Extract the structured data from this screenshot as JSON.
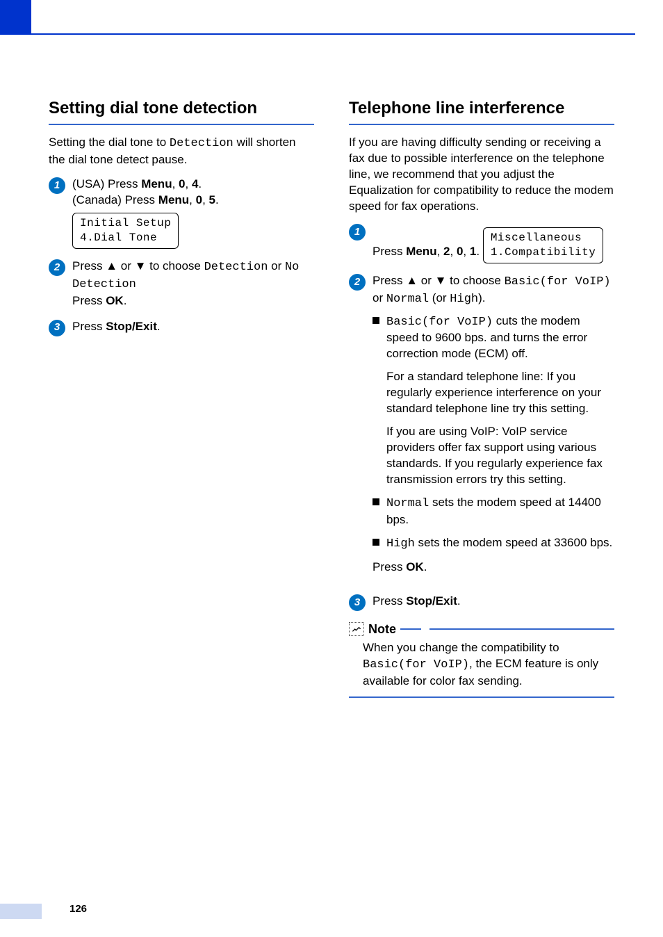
{
  "page_number": "126",
  "left": {
    "heading": "Setting dial tone detection",
    "intro_pre": "Setting the dial tone to ",
    "intro_mono": "Detection",
    "intro_post": " will shorten the dial tone detect pause.",
    "step1_usa_pre": "(USA) Press ",
    "step1_menu": "Menu",
    "sep1": ", ",
    "step1_a": "0",
    "step1_b": "4",
    "step1_canada_pre": "(Canada) Press ",
    "step1_c": "5",
    "step1_period": ".",
    "lcd": "Initial Setup\n4.Dial Tone",
    "step2_pre": "Press ",
    "step2_up": "a",
    "step2_or1": " or ",
    "step2_down": "b",
    "step2_mid": " to choose ",
    "step2_opt1": "Detection",
    "step2_or2": " or ",
    "step2_opt2": "No Detection",
    "step2_press": "Press ",
    "step2_ok": "OK",
    "step3_pre": "Press ",
    "step3_btn": "Stop/Exit"
  },
  "right": {
    "heading": "Telephone line interference",
    "intro": "If you are having difficulty sending or receiving a fax due to possible interference on the telephone line, we recommend that you adjust the Equalization for compatibility to reduce the modem speed for fax operations.",
    "step1_pre": "Press ",
    "step1_menu": "Menu",
    "sep": ", ",
    "step1_a": "2",
    "step1_b": "0",
    "step1_c": "1",
    "period": ".",
    "lcd": "Miscellaneous\n1.Compatibility",
    "step2_pre": "Press ",
    "step2_up": "a",
    "step2_or1": " or ",
    "step2_down": "b",
    "step2_mid": " to choose ",
    "step2_opt1": "Basic(for VoIP)",
    "step2_or2": " or ",
    "step2_opt2": "Normal",
    "step2_paren_or": " (or ",
    "step2_opt3": "High",
    "step2_paren_close": ").",
    "b1_mono": "Basic(for VoIP)",
    "b1_rest": " cuts the modem speed to 9600 bps. and turns the error correction mode (ECM) off.",
    "b1_p2": "For a standard telephone line: If you regularly experience interference on your standard telephone line try this setting.",
    "b1_p3": "If you are using VoIP: VoIP service providers offer fax support using various standards. If you regularly experience fax transmission errors try this setting.",
    "b2_mono": "Normal",
    "b2_rest": " sets the modem speed at 14400 bps.",
    "b3_mono": "High",
    "b3_rest": " sets the modem speed at 33600 bps.",
    "press": "Press ",
    "ok": "OK",
    "step3_pre": "Press ",
    "step3_btn": "Stop/Exit",
    "note_title": "Note",
    "note_pre": "When you change the compatibility to ",
    "note_mono": "Basic(for VoIP)",
    "note_post": ", the ECM feature is only available for color fax sending."
  }
}
